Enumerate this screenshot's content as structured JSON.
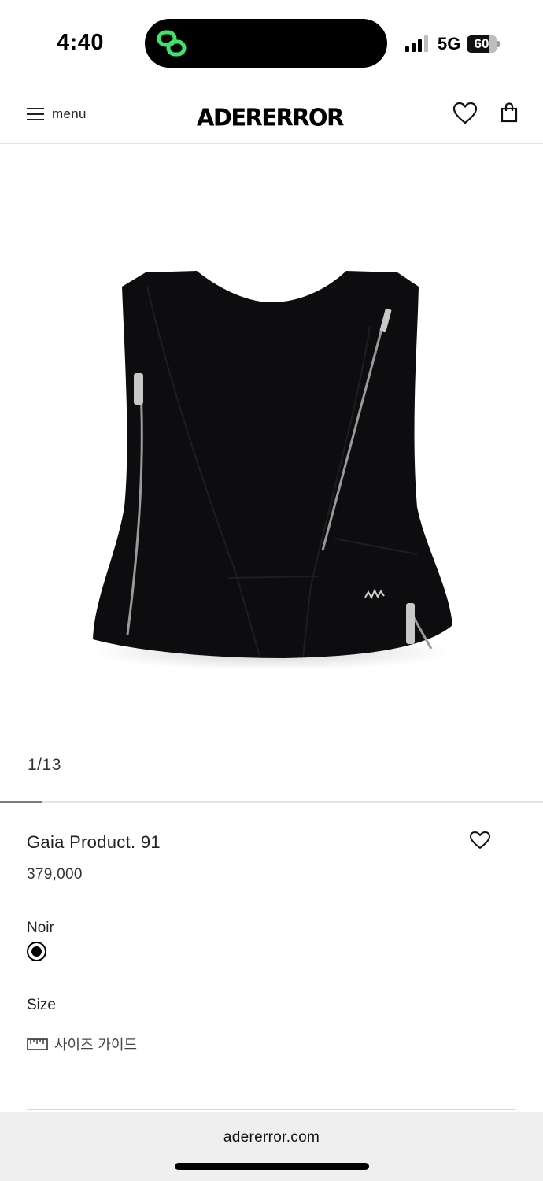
{
  "status_bar": {
    "time": "4:40",
    "network": "5G",
    "battery": "60"
  },
  "header": {
    "menu_label": "menu",
    "logo": "ADERERROR"
  },
  "gallery": {
    "counter": "1/13",
    "progress": 0.077
  },
  "product": {
    "name": "Gaia Product. 91",
    "price": "379,000",
    "color_label": "Noir",
    "size_label": "Size",
    "size_guide": "사이즈 가이드"
  },
  "browser": {
    "url": "adererror.com"
  },
  "colors": {
    "accent_green": "#3ee36a",
    "text": "#222222",
    "garment": "#0d0d0f"
  }
}
